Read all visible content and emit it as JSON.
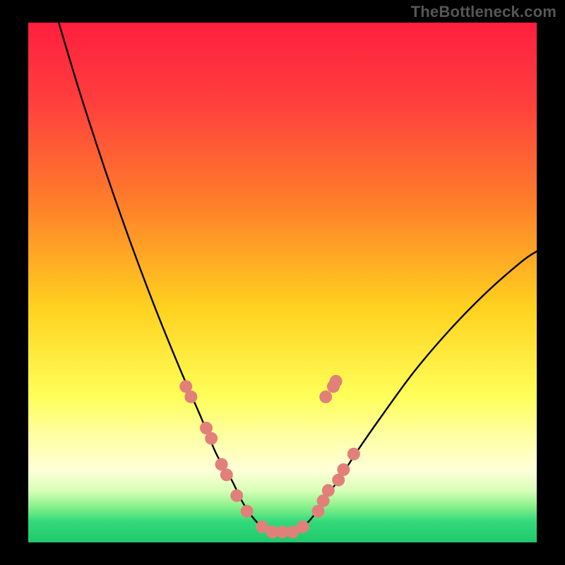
{
  "watermark": "TheBottleneck.com",
  "chart_data": {
    "type": "line",
    "title": "",
    "xlabel": "",
    "ylabel": "",
    "xlim": [
      0,
      100
    ],
    "ylim": [
      0,
      100
    ],
    "grid": false,
    "gradient_stops": [
      {
        "offset": 0.0,
        "color": "#ff1f3e"
      },
      {
        "offset": 0.15,
        "color": "#ff3e3e"
      },
      {
        "offset": 0.35,
        "color": "#ff7f2a"
      },
      {
        "offset": 0.55,
        "color": "#ffd21f"
      },
      {
        "offset": 0.72,
        "color": "#ffff5a"
      },
      {
        "offset": 0.8,
        "color": "#ffffa8"
      },
      {
        "offset": 0.86,
        "color": "#ffffd8"
      },
      {
        "offset": 0.9,
        "color": "#d9ffb8"
      },
      {
        "offset": 0.93,
        "color": "#8cf28c"
      },
      {
        "offset": 0.96,
        "color": "#33d97a"
      },
      {
        "offset": 1.0,
        "color": "#1fc96a"
      }
    ],
    "series": [
      {
        "name": "bottleneck-curve",
        "color": "#000000",
        "width": 2.4,
        "x": [
          6,
          10,
          15,
          20,
          25,
          30,
          34,
          37,
          40,
          42,
          44,
          46,
          48,
          50,
          52,
          54,
          56,
          58,
          61,
          65,
          70,
          76,
          83,
          90,
          97,
          100
        ],
        "y": [
          100,
          87,
          72,
          58,
          45,
          33,
          24,
          17,
          12,
          8,
          5,
          3,
          2,
          2,
          2,
          3,
          5,
          8,
          12,
          18,
          25,
          33,
          41,
          48,
          54,
          56
        ]
      }
    ],
    "scatter": {
      "name": "data-points",
      "color": "#e18079",
      "radius": 9,
      "points": [
        {
          "x": 31,
          "y": 30
        },
        {
          "x": 32,
          "y": 28
        },
        {
          "x": 35,
          "y": 22
        },
        {
          "x": 36,
          "y": 20
        },
        {
          "x": 38,
          "y": 15
        },
        {
          "x": 39,
          "y": 13
        },
        {
          "x": 41,
          "y": 9
        },
        {
          "x": 43,
          "y": 6
        },
        {
          "x": 46,
          "y": 3
        },
        {
          "x": 48,
          "y": 2
        },
        {
          "x": 50,
          "y": 2
        },
        {
          "x": 52,
          "y": 2
        },
        {
          "x": 54,
          "y": 3
        },
        {
          "x": 57,
          "y": 6
        },
        {
          "x": 58,
          "y": 8
        },
        {
          "x": 59,
          "y": 10
        },
        {
          "x": 61,
          "y": 12
        },
        {
          "x": 62,
          "y": 14
        },
        {
          "x": 64,
          "y": 17
        },
        {
          "x": 58.5,
          "y": 28
        },
        {
          "x": 60,
          "y": 30
        },
        {
          "x": 60.5,
          "y": 31
        }
      ]
    }
  }
}
